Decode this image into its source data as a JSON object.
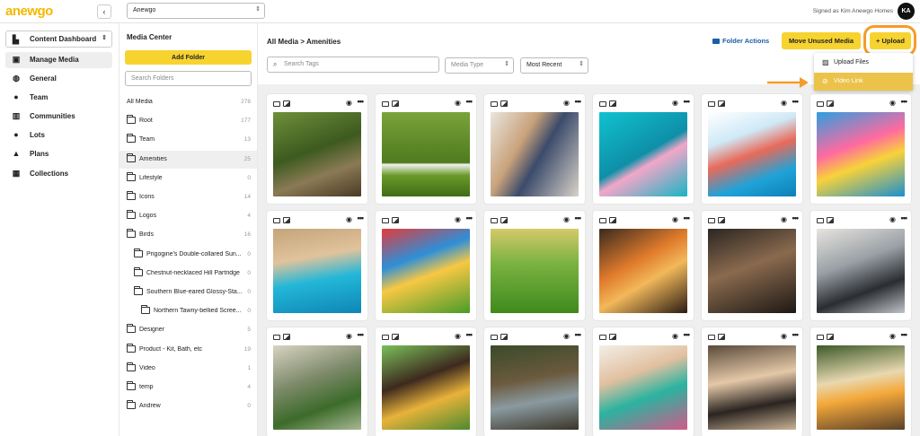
{
  "topbar": {
    "logo": "anewgo",
    "collapse_icon": "‹",
    "org_select": "Anewgo",
    "signed_in": "Signed as Kim Anewgo Homes",
    "avatar_initials": "KA"
  },
  "leftnav": {
    "dashboard_select": "Content Dashboard",
    "items": [
      {
        "label": "Manage Media",
        "icon": "media-icon",
        "glyph": "▣"
      },
      {
        "label": "General",
        "icon": "globe-icon",
        "glyph": "◍"
      },
      {
        "label": "Team",
        "icon": "team-icon",
        "glyph": "●"
      },
      {
        "label": "Communities",
        "icon": "buildings-icon",
        "glyph": "▥"
      },
      {
        "label": "Lots",
        "icon": "pin-icon",
        "glyph": "●"
      },
      {
        "label": "Plans",
        "icon": "home-icon",
        "glyph": "▲"
      },
      {
        "label": "Collections",
        "icon": "collections-icon",
        "glyph": "▦"
      }
    ]
  },
  "folders": {
    "title": "Media Center",
    "add_label": "Add Folder",
    "search_placeholder": "Search Folders",
    "rows": [
      {
        "name": "All Media",
        "count": "278"
      },
      {
        "name": "Root",
        "count": "177"
      },
      {
        "name": "Team",
        "count": "13"
      },
      {
        "name": "Amenities",
        "count": "25"
      },
      {
        "name": "Lifestyle",
        "count": "0"
      },
      {
        "name": "Icons",
        "count": "14"
      },
      {
        "name": "Logos",
        "count": "4"
      },
      {
        "name": "Birds",
        "count": "16"
      },
      {
        "name": "Prigogine's Double-collared Sun...",
        "count": "0"
      },
      {
        "name": "Chestnut-necklaced Hill Partridge",
        "count": "0"
      },
      {
        "name": "Southern Blue-eared Glossy-Sta...",
        "count": "0"
      },
      {
        "name": "Northern Tawny-bellied Scree...",
        "count": "0"
      },
      {
        "name": "Designer",
        "count": "5"
      },
      {
        "name": "Product - Kit, Bath, etc",
        "count": "19"
      },
      {
        "name": "Video",
        "count": "1"
      },
      {
        "name": "temp",
        "count": "4"
      },
      {
        "name": "Andrew",
        "count": "0"
      }
    ]
  },
  "main": {
    "breadcrumb": "All Media  >  Amenities",
    "folder_actions": "Folder Actions",
    "move_unused": "Move Unused Media",
    "upload": "+ Upload",
    "search_placeholder": "Search Tags",
    "media_type": "Media Type",
    "sort": "Most Recent"
  },
  "upload_menu": {
    "items": [
      {
        "label": "Upload Files",
        "glyph": "▨"
      },
      {
        "label": "Video Link",
        "glyph": "⊘"
      }
    ]
  },
  "colors": {
    "accent": "#f7d330",
    "highlight_ring": "#f59b2a",
    "link_blue": "#1a5ea8"
  }
}
